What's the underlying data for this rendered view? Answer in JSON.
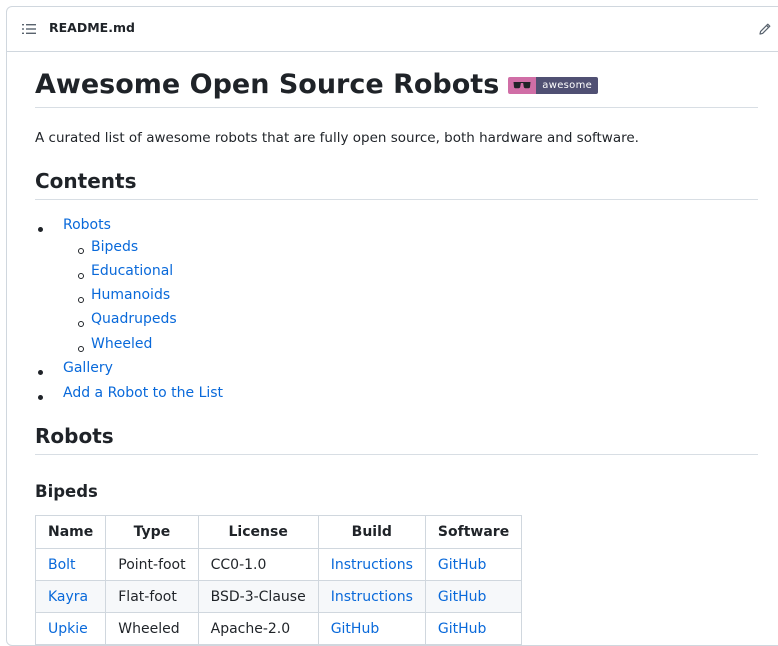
{
  "file_header": {
    "file_name": "README.md"
  },
  "readme": {
    "title": "Awesome Open Source Robots",
    "badge": {
      "icon": "sunglasses-icon",
      "label": "awesome",
      "left_color": "#d06ea6",
      "right_color": "#505073"
    },
    "intro": "A curated list of awesome robots that are fully open source, both hardware and software.",
    "contents_heading": "Contents",
    "toc": {
      "robots": "Robots",
      "sub": [
        "Bipeds",
        "Educational",
        "Humanoids",
        "Quadrupeds",
        "Wheeled"
      ],
      "gallery": "Gallery",
      "add_robot": "Add a Robot to the List"
    },
    "robots_heading": "Robots",
    "bipeds_heading": "Bipeds",
    "table": {
      "headers": [
        "Name",
        "Type",
        "License",
        "Build",
        "Software"
      ],
      "rows": [
        [
          "Bolt",
          "Point-foot",
          "CC0-1.0",
          "Instructions",
          "GitHub"
        ],
        [
          "Kayra",
          "Flat-foot",
          "BSD-3-Clause",
          "Instructions",
          "GitHub"
        ],
        [
          "Upkie",
          "Wheeled",
          "Apache-2.0",
          "GitHub",
          "GitHub"
        ]
      ]
    }
  },
  "colors": {
    "link": "#0969da",
    "text": "#1f2328",
    "border": "#d0d7de"
  }
}
